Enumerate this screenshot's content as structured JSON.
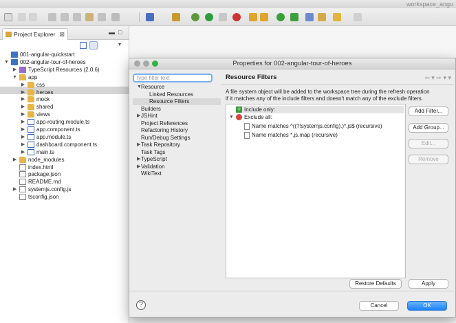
{
  "window": {
    "title": "workspace_angu"
  },
  "explorer": {
    "tab_label": "Project Explorer",
    "close_glyph": "⊠",
    "tree": [
      {
        "label": "001-angular-quickstart",
        "level": 0,
        "twisty": "",
        "icon": "proj"
      },
      {
        "label": "002-angular-tour-of-heroes",
        "level": 0,
        "twisty": "▼",
        "icon": "proj"
      },
      {
        "label": "TypeScript Resources (2.0.6)",
        "level": 1,
        "twisty": "▶",
        "icon": "lib"
      },
      {
        "label": "app",
        "level": 1,
        "twisty": "▼",
        "icon": "folder"
      },
      {
        "label": "css",
        "level": 2,
        "twisty": "▶",
        "icon": "folder"
      },
      {
        "label": "heroes",
        "level": 2,
        "twisty": "▶",
        "icon": "folder"
      },
      {
        "label": "mock",
        "level": 2,
        "twisty": "▶",
        "icon": "folder"
      },
      {
        "label": "shared",
        "level": 2,
        "twisty": "▶",
        "icon": "folder"
      },
      {
        "label": "views",
        "level": 2,
        "twisty": "▶",
        "icon": "folder"
      },
      {
        "label": "app-routing.module.ts",
        "level": 2,
        "twisty": "▶",
        "icon": "ts"
      },
      {
        "label": "app.component.ts",
        "level": 2,
        "twisty": "▶",
        "icon": "ts"
      },
      {
        "label": "app.module.ts",
        "level": 2,
        "twisty": "▶",
        "icon": "ts"
      },
      {
        "label": "dashboard.component.ts",
        "level": 2,
        "twisty": "▶",
        "icon": "ts"
      },
      {
        "label": "main.ts",
        "level": 2,
        "twisty": "▶",
        "icon": "ts"
      },
      {
        "label": "node_modules",
        "level": 1,
        "twisty": "▶",
        "icon": "folder"
      },
      {
        "label": "index.html",
        "level": 1,
        "twisty": "",
        "icon": "file"
      },
      {
        "label": "package.json",
        "level": 1,
        "twisty": "",
        "icon": "file"
      },
      {
        "label": "README.md",
        "level": 1,
        "twisty": "",
        "icon": "file"
      },
      {
        "label": "systemjs.config.js",
        "level": 1,
        "twisty": "▶",
        "icon": "file"
      },
      {
        "label": "tsconfig.json",
        "level": 1,
        "twisty": "",
        "icon": "file"
      }
    ]
  },
  "dialog": {
    "title": "Properties for 002-angular-tour-of-heroes",
    "filter_placeholder": "type filter text",
    "nav_items": [
      {
        "label": "Resource",
        "twisty": "▼",
        "indent": 0,
        "selected": false
      },
      {
        "label": "Linked Resources",
        "twisty": "",
        "indent": 1,
        "selected": false
      },
      {
        "label": "Resource Filters",
        "twisty": "",
        "indent": 1,
        "selected": true
      },
      {
        "label": "Builders",
        "twisty": "",
        "indent": 0,
        "selected": false
      },
      {
        "label": "JSHint",
        "twisty": "▶",
        "indent": 0,
        "selected": false
      },
      {
        "label": "Project References",
        "twisty": "",
        "indent": 0,
        "selected": false
      },
      {
        "label": "Refactoring History",
        "twisty": "",
        "indent": 0,
        "selected": false
      },
      {
        "label": "Run/Debug Settings",
        "twisty": "",
        "indent": 0,
        "selected": false
      },
      {
        "label": "Task Repository",
        "twisty": "▶",
        "indent": 0,
        "selected": false
      },
      {
        "label": "Task Tags",
        "twisty": "",
        "indent": 0,
        "selected": false
      },
      {
        "label": "TypeScript",
        "twisty": "▶",
        "indent": 0,
        "selected": false
      },
      {
        "label": "Validation",
        "twisty": "▶",
        "indent": 0,
        "selected": false
      },
      {
        "label": "WikiText",
        "twisty": "",
        "indent": 0,
        "selected": false
      }
    ],
    "page_title": "Resource Filters",
    "description_line1": "A file system object will be added to the workspace tree during the refresh operation",
    "description_line2": "if it matches any of the include filters and doesn't match any of the exclude filters.",
    "include_label": "Include only:",
    "exclude_label": "Exclude all:",
    "rules": [
      {
        "label": "Name matches ^((?!systemjs.config).)*.js$   (recursive)"
      },
      {
        "label": "Name matches *.js.map   (recursive)"
      }
    ],
    "buttons": {
      "add_filter": "Add Filter...",
      "add_group": "Add Group...",
      "edit": "Edit...",
      "remove": "Remove",
      "restore_defaults": "Restore Defaults",
      "apply": "Apply",
      "cancel": "Cancel",
      "ok": "OK"
    },
    "help_glyph": "?"
  },
  "colors": {
    "accent": "#1a82fb",
    "selection": "#d5d5d5"
  }
}
